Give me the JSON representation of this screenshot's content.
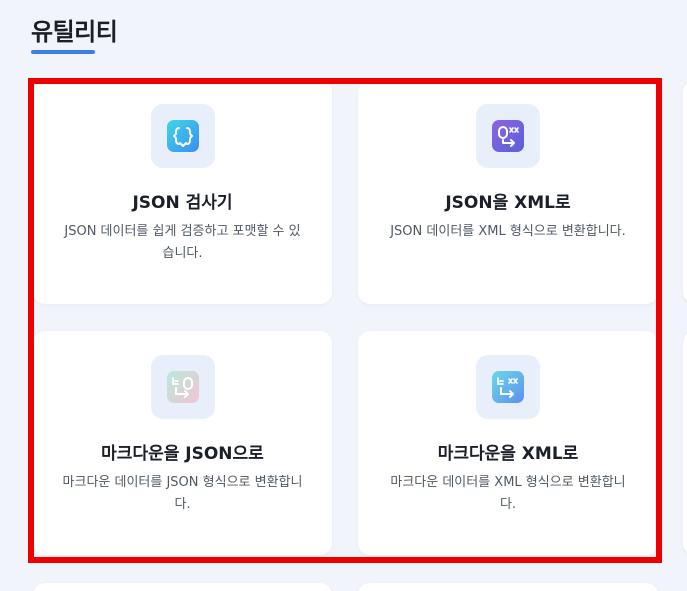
{
  "section": {
    "title": "유틸리티"
  },
  "cards": [
    {
      "title": "JSON 검사기",
      "description": "JSON 데이터를 쉽게 검증하고 포맷할 수 있습니다.",
      "icon": "json-validator-icon"
    },
    {
      "title": "JSON을 XML로",
      "description": "JSON 데이터를 XML 형식으로 변환합니다.",
      "icon": "json-to-xml-icon"
    },
    {
      "title": "마크다운을 JSON으로",
      "description": "마크다운 데이터를 JSON 형식으로 변환합니다.",
      "icon": "markdown-to-json-icon"
    },
    {
      "title": "마크다운을 XML로",
      "description": "마크다운 데이터를 XML 형식으로 변환합니다.",
      "icon": "markdown-to-xml-icon"
    }
  ],
  "colors": {
    "accent": "#3d7ee8",
    "highlight": "#ee0000",
    "background": "#f1f4fa"
  }
}
